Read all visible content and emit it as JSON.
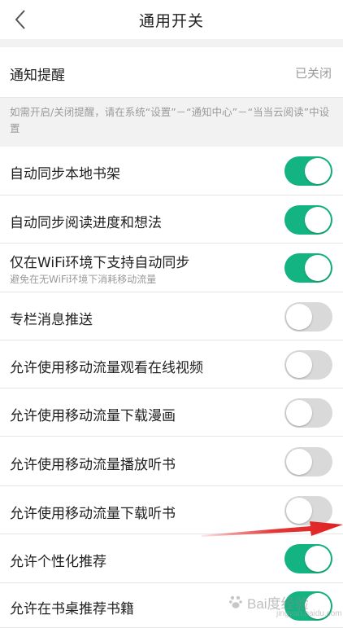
{
  "header": {
    "title": "通用开关",
    "back_icon": "chevron-left-icon"
  },
  "notify": {
    "label": "通知提醒",
    "value": "已关闭",
    "note": "如需开启/关闭提醒，请在系统“设置”－“通知中心”－“当当云阅读”中设置"
  },
  "settings": [
    {
      "label": "自动同步本地书架",
      "on": true
    },
    {
      "label": "自动同步阅读进度和想法",
      "on": true
    },
    {
      "label": "仅在WiFi环境下支持自动同步",
      "sub": "避免在无WiFi环境下消耗移动流量",
      "on": true
    },
    {
      "label": "专栏消息推送",
      "on": false
    },
    {
      "label": "允许使用移动流量观看在线视频",
      "on": false
    },
    {
      "label": "允许使用移动流量下载漫画",
      "on": false
    },
    {
      "label": "允许使用移动流量播放听书",
      "on": false
    },
    {
      "label": "允许使用移动流量下载听书",
      "on": false
    },
    {
      "label": "允许个性化推荐",
      "on": true
    },
    {
      "label": "允许在书桌推荐书籍",
      "on": true
    }
  ],
  "colors": {
    "toggle_on": "#14b482",
    "toggle_off": "#d9d9d9",
    "arrow": "#e02020"
  },
  "watermark": {
    "text": "Bai度经验",
    "sub": "jingyan.baidu.com"
  }
}
